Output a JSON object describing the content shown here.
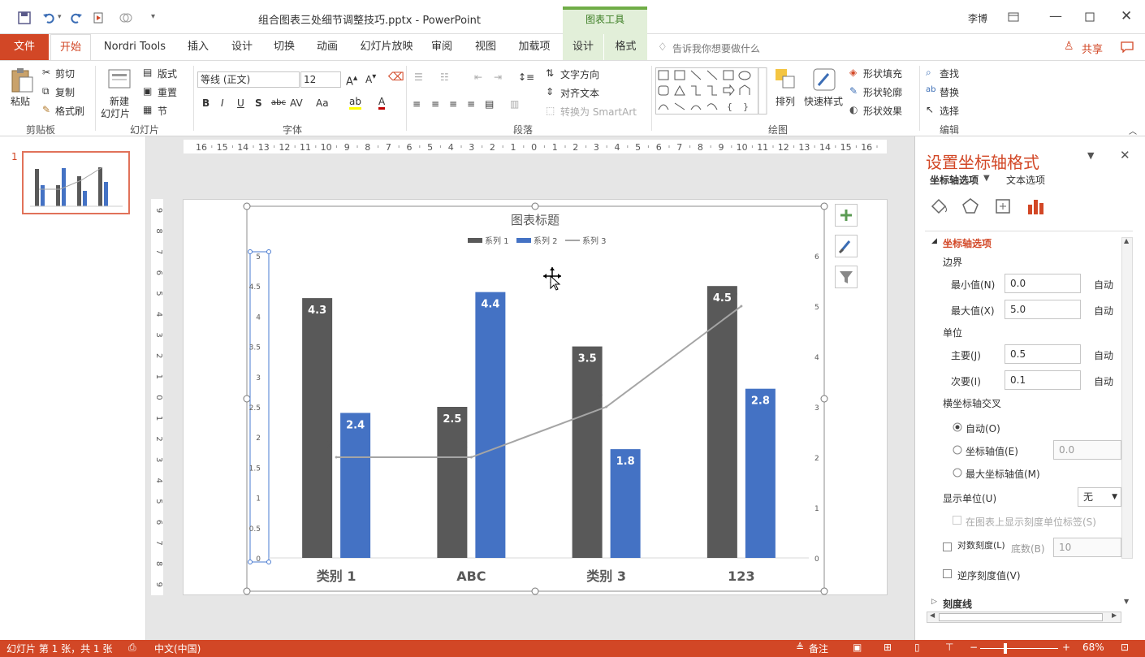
{
  "window": {
    "title": "组合图表三处细节调整技巧.pptx - PowerPoint",
    "context_tool": "图表工具",
    "user": "李博"
  },
  "tabs": [
    "文件",
    "开始",
    "Nordri Tools",
    "插入",
    "设计",
    "切换",
    "动画",
    "幻灯片放映",
    "审阅",
    "视图",
    "加载项",
    "设计",
    "格式"
  ],
  "tellme": "告诉我你想要做什么",
  "share": "共享",
  "ribbon": {
    "clipboard": {
      "paste": "粘贴",
      "cut": "剪切",
      "copy": "复制",
      "format_painter": "格式刷",
      "label": "剪贴板"
    },
    "slides": {
      "new_slide_1": "新建",
      "new_slide_2": "幻灯片",
      "layout": "版式",
      "reset": "重置",
      "section": "节",
      "label": "幻灯片"
    },
    "font": {
      "name": "等线 (正文)",
      "size": "12",
      "label": "字体"
    },
    "paragraph": {
      "text_direction": "文字方向",
      "align_text": "对齐文本",
      "smartart": "转换为 SmartArt",
      "label": "段落"
    },
    "drawing": {
      "arrange": "排列",
      "quick_styles": "快速样式",
      "fill": "形状填充",
      "outline": "形状轮廓",
      "effects": "形状效果",
      "label": "绘图"
    },
    "editing": {
      "find": "查找",
      "replace": "替换",
      "select": "选择",
      "label": "编辑"
    }
  },
  "thumbnail_number": "1",
  "hruler_ticks": [
    "16",
    "15",
    "14",
    "13",
    "12",
    "11",
    "10",
    "9",
    "8",
    "7",
    "6",
    "5",
    "4",
    "3",
    "2",
    "1",
    "0",
    "1",
    "2",
    "3",
    "4",
    "5",
    "6",
    "7",
    "8",
    "9",
    "10",
    "11",
    "12",
    "13",
    "14",
    "15",
    "16"
  ],
  "vruler_ticks": [
    "9",
    "8",
    "7",
    "6",
    "5",
    "4",
    "3",
    "2",
    "1",
    "0",
    "1",
    "2",
    "3",
    "4",
    "5",
    "6",
    "7",
    "8",
    "9"
  ],
  "chart_data": {
    "type": "bar",
    "title": "图表标题",
    "categories": [
      "类别 1",
      "ABC",
      "类别 3",
      "123"
    ],
    "series": [
      {
        "name": "系列 1",
        "type": "bar",
        "values": [
          4.3,
          2.5,
          3.5,
          4.5
        ],
        "color": "#595959"
      },
      {
        "name": "系列 2",
        "type": "bar",
        "values": [
          2.4,
          4.4,
          1.8,
          2.8
        ],
        "color": "#4472c4"
      },
      {
        "name": "系列 3",
        "type": "line",
        "axis": "secondary",
        "values": [
          2,
          2,
          3,
          5
        ],
        "color": "#a5a5a5"
      }
    ],
    "y_primary": {
      "min": 0,
      "max": 5,
      "ticks": [
        "0",
        "0.5",
        "1",
        "1.5",
        "2",
        "2.5",
        "3",
        "3.5",
        "4",
        "4.5",
        "5"
      ]
    },
    "y_secondary": {
      "min": 0,
      "max": 6,
      "ticks": [
        "0",
        "1",
        "2",
        "3",
        "4",
        "5",
        "6"
      ]
    },
    "legend": "top",
    "grid": false
  },
  "pane": {
    "title": "设置坐标轴格式",
    "tab_axis": "坐标轴选项",
    "tab_text": "文本选项",
    "section": "坐标轴选项",
    "bounds": "边界",
    "min_label": "最小值(N)",
    "min_value": "0.0",
    "max_label": "最大值(X)",
    "max_value": "5.0",
    "units": "单位",
    "major_label": "主要(J)",
    "major_value": "0.5",
    "minor_label": "次要(I)",
    "minor_value": "0.1",
    "auto": "自动",
    "cross": "横坐标轴交叉",
    "cross_auto": "自动(O)",
    "cross_value_label": "坐标轴值(E)",
    "cross_value": "0.0",
    "cross_max": "最大坐标轴值(M)",
    "display_units": "显示单位(U)",
    "display_units_value": "无",
    "show_units_label": "在图表上显示刻度单位标签(S)",
    "log_scale": "对数刻度(L)",
    "base_label": "底数(B)",
    "base_value": "10",
    "reverse": "逆序刻度值(V)",
    "ticks_section": "刻度线"
  },
  "status": {
    "slide_info": "幻灯片 第 1 张，共 1 张",
    "language": "中文(中国)",
    "notes": "备注",
    "zoom": "68%"
  },
  "colors": {
    "accent": "#d24726",
    "chart_tools": "#70ad47"
  }
}
